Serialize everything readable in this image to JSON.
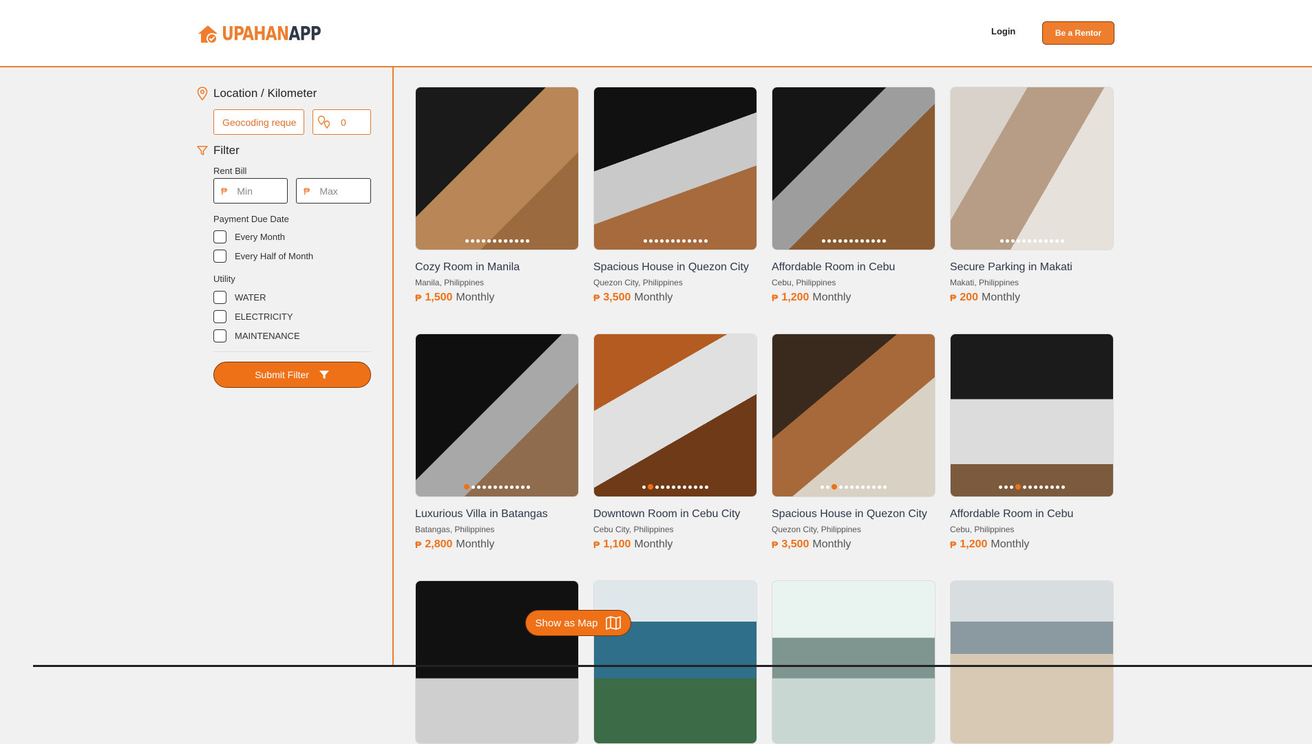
{
  "brand": {
    "part1": "UPAHAN",
    "part2": "APP",
    "accent": "#ee7d2d"
  },
  "header": {
    "login_label": "Login",
    "renter_label": "Be a Rentor"
  },
  "sidebar": {
    "location_title": "Location / Kilometer",
    "geocode_value": "Geocoding reque",
    "km_value": "0",
    "filter_title": "Filter",
    "rent_bill_label": "Rent Bill",
    "currency_symbol": "₱",
    "min_placeholder": "Min",
    "max_placeholder": "Max",
    "payment_due_label": "Payment Due Date",
    "payment_options": [
      "Every Month",
      "Every Half of Month"
    ],
    "utility_label": "Utility",
    "utility_options": [
      "WATER",
      "ELECTRICITY",
      "MAINTENANCE"
    ],
    "submit_label": "Submit Filter"
  },
  "listings": [
    {
      "title": "Cozy Room in Manila",
      "location": "Manila, Philippines",
      "price": "1,500",
      "period": "Monthly",
      "dots": 12,
      "active_dot": -1
    },
    {
      "title": "Spacious House in Quezon City",
      "location": "Quezon City, Philippines",
      "price": "3,500",
      "period": "Monthly",
      "dots": 12,
      "active_dot": -1
    },
    {
      "title": "Affordable Room in Cebu",
      "location": "Cebu, Philippines",
      "price": "1,200",
      "period": "Monthly",
      "dots": 12,
      "active_dot": -1
    },
    {
      "title": "Secure Parking in Makati",
      "location": "Makati, Philippines",
      "price": "200",
      "period": "Monthly",
      "dots": 12,
      "active_dot": -1
    },
    {
      "title": "Luxurious Villa in Batangas",
      "location": "Batangas, Philippines",
      "price": "2,800",
      "period": "Monthly",
      "dots": 12,
      "active_dot": 0
    },
    {
      "title": "Downtown Room in Cebu City",
      "location": "Cebu City, Philippines",
      "price": "1,100",
      "period": "Monthly",
      "dots": 12,
      "active_dot": 1
    },
    {
      "title": "Spacious House in Quezon City",
      "location": "Quezon City, Philippines",
      "price": "3,500",
      "period": "Monthly",
      "dots": 12,
      "active_dot": 2
    },
    {
      "title": "Affordable Room in Cebu",
      "location": "Cebu, Philippines",
      "price": "1,200",
      "period": "Monthly",
      "dots": 12,
      "active_dot": 3
    },
    {
      "title": "",
      "location": "",
      "price": "",
      "period": "",
      "dots": 0,
      "active_dot": -1
    },
    {
      "title": "",
      "location": "",
      "price": "",
      "period": "",
      "dots": 0,
      "active_dot": -1
    },
    {
      "title": "",
      "location": "",
      "price": "",
      "period": "",
      "dots": 0,
      "active_dot": -1
    },
    {
      "title": "",
      "location": "",
      "price": "",
      "period": "",
      "dots": 0,
      "active_dot": -1
    }
  ],
  "map_button_label": "Show as Map"
}
